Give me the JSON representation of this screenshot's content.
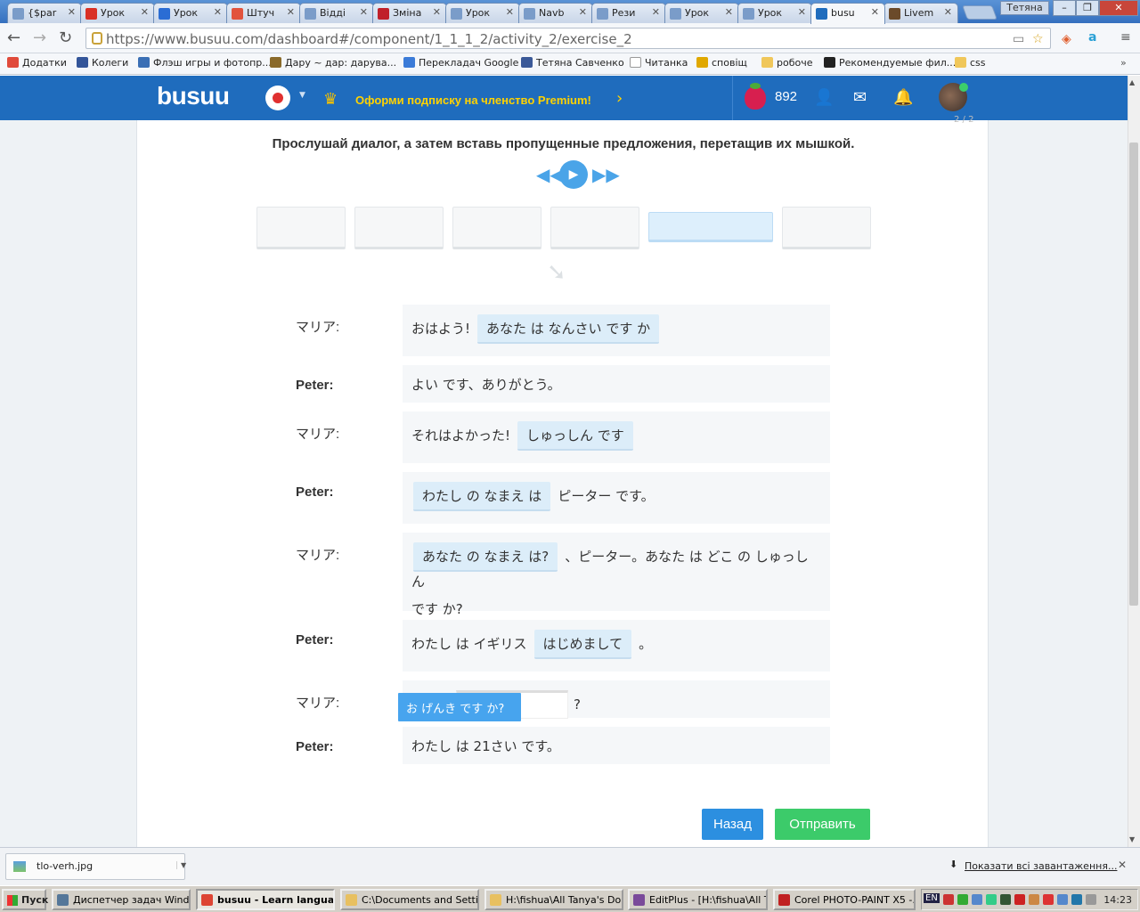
{
  "browser": {
    "tabs": [
      {
        "label": "{$par",
        "icon": "doc-icon",
        "color": "#7a9cc9"
      },
      {
        "label": "Урок",
        "icon": "gmail-icon",
        "color": "#d93025"
      },
      {
        "label": "Урок",
        "icon": "word-icon",
        "color": "#2b6dd4"
      },
      {
        "label": "Штуч",
        "icon": "ph-icon",
        "color": "#e2533d"
      },
      {
        "label": "Відді",
        "icon": "doc-icon",
        "color": "#7a9cc9"
      },
      {
        "label": "Змінa",
        "icon": "znu-icon",
        "color": "#c0202a"
      },
      {
        "label": "Урок",
        "icon": "doc-icon",
        "color": "#7a9cc9"
      },
      {
        "label": "Navb",
        "icon": "doc-icon",
        "color": "#7a9cc9"
      },
      {
        "label": "Рези",
        "icon": "doc-icon",
        "color": "#7a9cc9"
      },
      {
        "label": "Урок",
        "icon": "doc-icon",
        "color": "#7a9cc9"
      },
      {
        "label": "Урок",
        "icon": "doc-icon",
        "color": "#7a9cc9"
      },
      {
        "label": "busu",
        "icon": "busuu-icon",
        "color": "#1f6cbd",
        "active": true
      },
      {
        "label": "Livem",
        "icon": "livemocha-icon",
        "color": "#6b4a2a"
      }
    ],
    "user_label": "Тетяна",
    "url": "https://www.busuu.com/dashboard#/component/1_1_1_2/activity_2/exercise_2",
    "bookmarks": [
      {
        "label": "Додатки",
        "icon": "apps-icon",
        "color": "#e04a3a"
      },
      {
        "label": "Колеги",
        "icon": "person-icon",
        "color": "#335599"
      },
      {
        "label": "Флэш игры и фотопр...",
        "icon": "v-icon",
        "color": "#3a6fb5"
      },
      {
        "label": "Дару ~ дар: дарува...",
        "icon": "mustache-icon",
        "color": "#8a6a2a"
      },
      {
        "label": "Перекладач Google",
        "icon": "translate-icon",
        "color": "#3b7bd8"
      },
      {
        "label": "Тетяна Савченко",
        "icon": "facebook-icon",
        "color": "#3b5998"
      },
      {
        "label": "Читанка",
        "icon": "page-icon",
        "color": "#ffffff"
      },
      {
        "label": "сповіщ",
        "icon": "crown-icon",
        "color": "#e0a800"
      },
      {
        "label": "робоче",
        "icon": "folder-icon",
        "color": "#f0c75a"
      },
      {
        "label": "Рекомендуемые фил...",
        "icon": "k-icon",
        "color": "#222222"
      },
      {
        "label": "css",
        "icon": "folder-icon",
        "color": "#f0c75a"
      }
    ]
  },
  "header": {
    "logo": "busuu",
    "premium_text": "Оформи подписку на членство Premium!",
    "points": "892",
    "brand_color": "#1f6cbd"
  },
  "exercise": {
    "progress": "2 / 2",
    "instruction": "Прослушай диалог, а затем вставь пропущенные предложения, перетащив их мышкой.",
    "dragged_chip": "お げんき です か?",
    "dialog": [
      {
        "speaker": "マリア:",
        "before": "おはよう!",
        "chip": "あなた は なんさい です か",
        "after": ""
      },
      {
        "speaker": "Peter:",
        "text": "よい です、ありがとう。"
      },
      {
        "speaker": "マリア:",
        "before": "それはよかった!",
        "chip": "しゅっしん です",
        "after": ""
      },
      {
        "speaker": "Peter:",
        "before": "",
        "chip": "わたし の なまえ は",
        "after": "ピーター です。"
      },
      {
        "speaker": "マリア:",
        "before": "",
        "chip": "あなた の なまえ は?",
        "after": "、ピーター。あなた は どこ の しゅっしん",
        "line2": "です か?"
      },
      {
        "speaker": "Peter:",
        "before": "わたし は イギリス",
        "chip": "はじめまして",
        "after": "。"
      },
      {
        "speaker": "マリア:",
        "before": "",
        "chip": "",
        "after": "?"
      },
      {
        "speaker": "Peter:",
        "text": "わたし は 21さい です。"
      }
    ],
    "back_label": "Назад",
    "send_label": "Отправить"
  },
  "downloads": {
    "file": "tlo-verh.jpg",
    "show_all": "Показати всі завантаження..."
  },
  "taskbar": {
    "start": "Пуск",
    "tasks": [
      {
        "label": "Диспетчер задач Wind...",
        "color": "#557799"
      },
      {
        "label": "busuu - Learn langua...",
        "color": "#dd4433",
        "active": true
      },
      {
        "label": "C:\\Documents and Setti...",
        "color": "#e8c060"
      },
      {
        "label": "H:\\fishua\\All Tanya's Do...",
        "color": "#e8c060"
      },
      {
        "label": "EditPlus - [H:\\fishua\\All T...",
        "color": "#7a4a9a"
      },
      {
        "label": "Corel PHOTO-PAINT X5 -...",
        "color": "#c02020"
      }
    ],
    "clock": "14:23",
    "lang": "EN"
  }
}
